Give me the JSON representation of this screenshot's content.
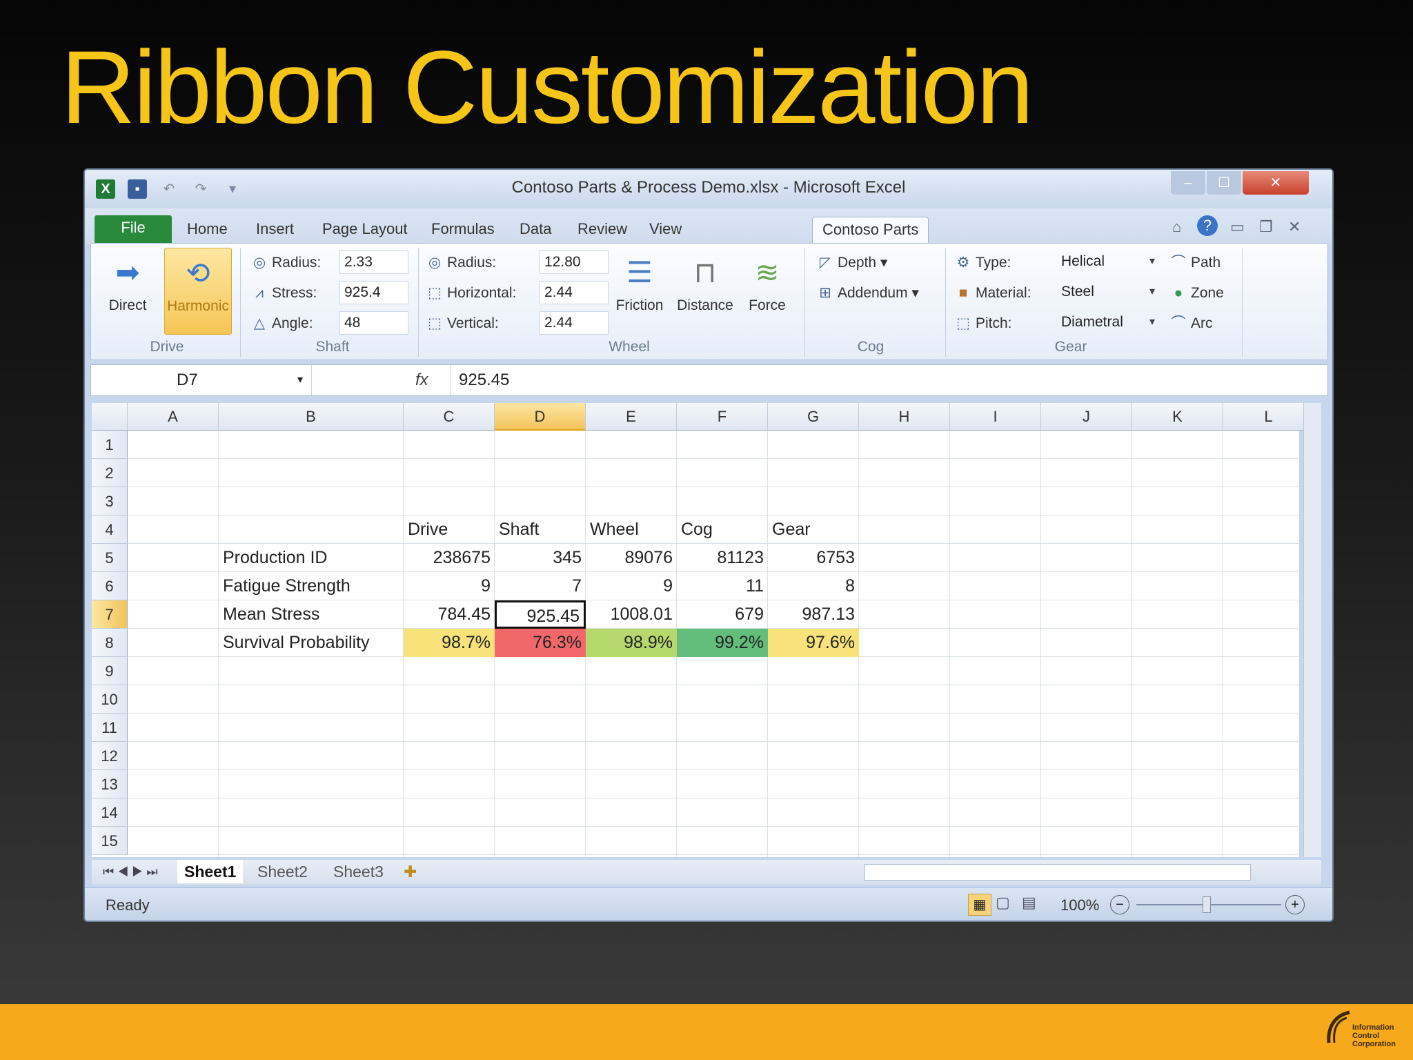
{
  "slide": {
    "title": "Ribbon Customization"
  },
  "window": {
    "title": "Contoso Parts & Process Demo.xlsx - Microsoft Excel",
    "controls": {
      "minimize": "–",
      "maximize": "☐",
      "close": "✕"
    }
  },
  "tabs": [
    "File",
    "Home",
    "Insert",
    "Page Layout",
    "Formulas",
    "Data",
    "Review",
    "View",
    "Contoso Parts"
  ],
  "active_tab": "Contoso Parts",
  "ribbon": {
    "drive": {
      "label": "Drive",
      "direct": "Direct",
      "harmonic": "Harmonic"
    },
    "shaft": {
      "label": "Shaft",
      "radius_label": "Radius:",
      "radius_value": "2.33",
      "stress_label": "Stress:",
      "stress_value": "925.4",
      "angle_label": "Angle:",
      "angle_value": "48"
    },
    "wheel": {
      "label": "Wheel",
      "radius_label": "Radius:",
      "radius_value": "12.80",
      "horizontal_label": "Horizontal:",
      "horizontal_value": "2.44",
      "vertical_label": "Vertical:",
      "vertical_value": "2.44",
      "friction": "Friction",
      "distance": "Distance",
      "force": "Force"
    },
    "cog": {
      "label": "Cog",
      "depth": "Depth",
      "addendum": "Addendum"
    },
    "gear": {
      "label": "Gear",
      "type_label": "Type:",
      "type_value": "Helical",
      "material_label": "Material:",
      "material_value": "Steel",
      "pitch_label": "Pitch:",
      "pitch_value": "Diametral",
      "path": "Path",
      "zone": "Zone",
      "arc": "Arc"
    }
  },
  "formula_bar": {
    "name_box": "D7",
    "fx": "fx",
    "value": "925.45"
  },
  "grid": {
    "columns": [
      "A",
      "B",
      "C",
      "D",
      "E",
      "F",
      "G",
      "H",
      "I",
      "J",
      "K",
      "L"
    ],
    "rows": [
      "1",
      "2",
      "3",
      "4",
      "5",
      "6",
      "7",
      "8",
      "9",
      "10",
      "11",
      "12",
      "13",
      "14",
      "15"
    ],
    "selected_column": "D",
    "selected_row": "7",
    "headers": [
      "Drive",
      "Shaft",
      "Wheel",
      "Cog",
      "Gear"
    ],
    "data_rows": [
      {
        "label": "Production ID",
        "values": [
          "238675",
          "345",
          "89076",
          "81123",
          "6753"
        ]
      },
      {
        "label": "Fatigue Strength",
        "values": [
          "9",
          "7",
          "9",
          "11",
          "8"
        ]
      },
      {
        "label": "Mean Stress",
        "values": [
          "784.45",
          "925.45",
          "1008.01",
          "679",
          "987.13"
        ]
      },
      {
        "label": "Survival Probability",
        "values": [
          "98.7%",
          "76.3%",
          "98.9%",
          "99.2%",
          "97.6%"
        ]
      }
    ],
    "survival_colors": [
      "#f8e37a",
      "#f2686a",
      "#b6d96e",
      "#63be7b",
      "#f8e37a"
    ]
  },
  "sheets": [
    "Sheet1",
    "Sheet2",
    "Sheet3"
  ],
  "active_sheet": "Sheet1",
  "status": {
    "ready": "Ready",
    "zoom": "100%"
  }
}
